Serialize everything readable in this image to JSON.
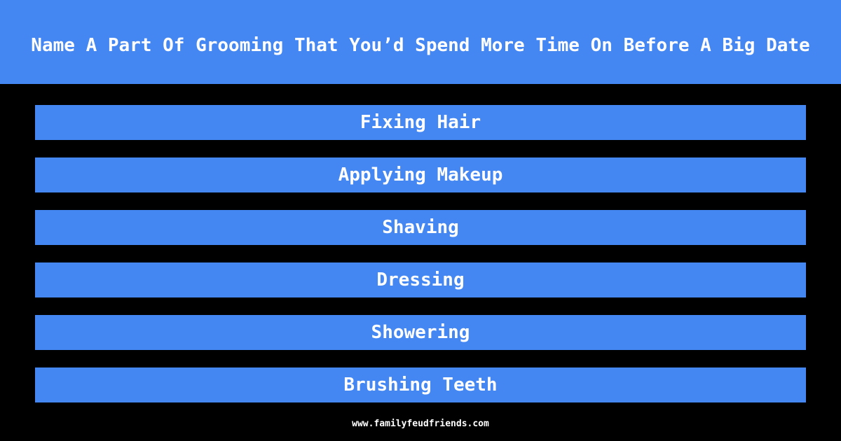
{
  "question": "Name A Part Of Grooming That You’d Spend More Time On Before A Big Date",
  "answers": [
    {
      "label": "Fixing Hair"
    },
    {
      "label": "Applying Makeup"
    },
    {
      "label": "Shaving"
    },
    {
      "label": "Dressing"
    },
    {
      "label": "Showering"
    },
    {
      "label": "Brushing Teeth"
    }
  ],
  "footer": "www.familyfeudfriends.com",
  "colors": {
    "accent": "#4487f3",
    "background": "#000000",
    "text": "#ffffff"
  }
}
